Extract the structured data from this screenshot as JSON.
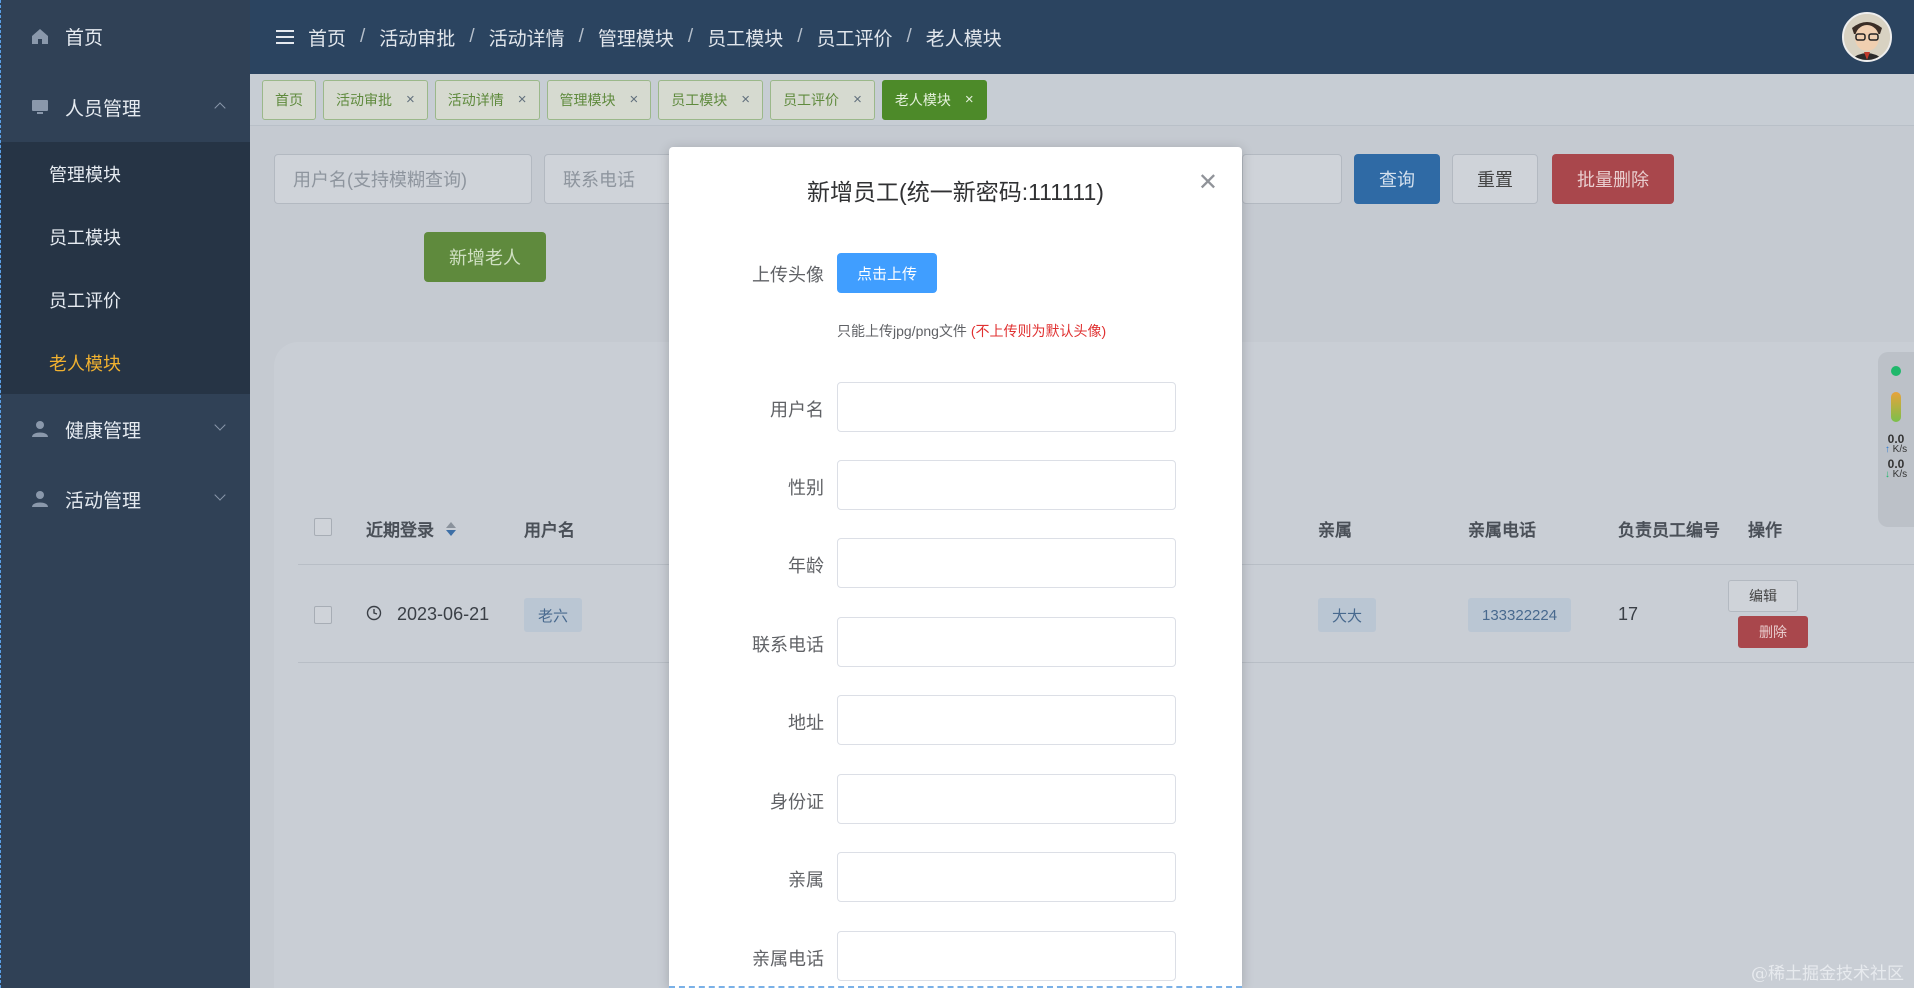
{
  "sidebar": {
    "home_label": "首页",
    "groups": [
      {
        "label": "人员管理",
        "expanded": true
      },
      {
        "label": "健康管理",
        "expanded": false
      },
      {
        "label": "活动管理",
        "expanded": false
      }
    ],
    "sub_items": [
      "管理模块",
      "员工模块",
      "员工评价",
      "老人模块"
    ],
    "active_sub": "老人模块"
  },
  "navbar": {
    "breadcrumbs": [
      "首页",
      "活动审批",
      "活动详情",
      "管理模块",
      "员工模块",
      "员工评价",
      "老人模块"
    ]
  },
  "tags": [
    {
      "label": "首页",
      "closable": false
    },
    {
      "label": "活动审批",
      "closable": true
    },
    {
      "label": "活动详情",
      "closable": true
    },
    {
      "label": "管理模块",
      "closable": true
    },
    {
      "label": "员工模块",
      "closable": true
    },
    {
      "label": "员工评价",
      "closable": true
    },
    {
      "label": "老人模块",
      "closable": true,
      "active": true
    }
  ],
  "filters": {
    "username_placeholder": "用户名(支持模糊查询)",
    "phone_placeholder": "联系电话",
    "search_button": "查询",
    "reset_button": "重置",
    "batch_delete_button": "批量删除",
    "add_button": "新增老人"
  },
  "table": {
    "headers": {
      "recent_login": "近期登录",
      "username": "用户名",
      "relative": "亲属",
      "relative_phone": "亲属电话",
      "staff_id": "负责员工编号",
      "actions": "操作"
    },
    "rows": [
      {
        "date": "2023-06-21",
        "username": "老六",
        "relative": "大大",
        "relative_phone": "133322224",
        "staff_id": "17",
        "edit": "编辑",
        "delete": "删除"
      }
    ]
  },
  "widget": {
    "up": "0.0",
    "up_unit": "K/s",
    "down": "0.0",
    "down_unit": "K/s"
  },
  "modal": {
    "title": "新增员工(统一新密码:111111)",
    "avatar_label": "上传头像",
    "upload_button": "点击上传",
    "tip": "只能上传jpg/png文件",
    "tip_note": "(不上传则为默认头像)",
    "fields": [
      "用户名",
      "性别",
      "年龄",
      "联系电话",
      "地址",
      "身份证",
      "亲属",
      "亲属电话"
    ]
  },
  "watermark": "@稀土掘金技术社区",
  "colors": {
    "sidebar_bg": "#304156",
    "navbar_bg": "#2b4460",
    "active_menu": "#f0b130",
    "primary": "#409eff",
    "tip_red": "#e03131"
  }
}
